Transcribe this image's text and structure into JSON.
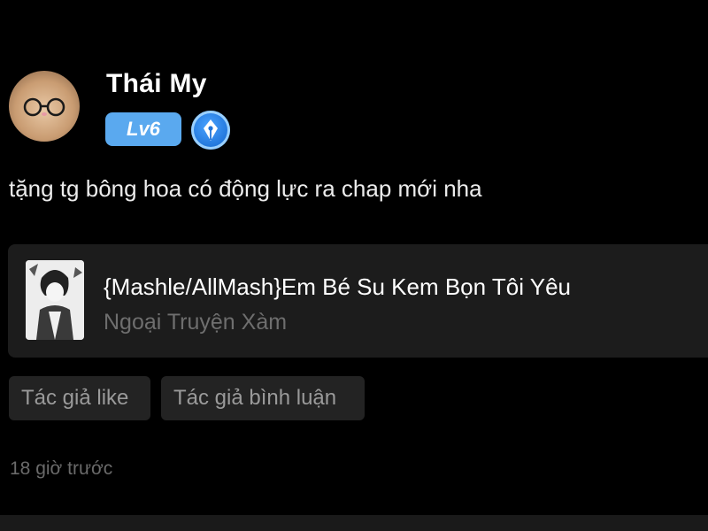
{
  "user": {
    "name": "Thái My",
    "level": "Lv6"
  },
  "comment": {
    "text": "tặng tg bông hoa có động lực ra chap mới nha",
    "time": "18 giờ trước"
  },
  "story": {
    "title": "{Mashle/AllMash}Em Bé Su Kem Bọn Tôi Yêu",
    "subtitle": "Ngoại Truyện Xàm"
  },
  "actions": {
    "like_label": "Tác giả like",
    "comment_label": "Tác giả bình luận"
  },
  "colors": {
    "background": "#000000",
    "card": "#1c1c1c",
    "level_badge": "#5aa9ef",
    "author_badge": "#1f73d8"
  },
  "icons": {
    "author_badge": "pen-nib-icon"
  }
}
